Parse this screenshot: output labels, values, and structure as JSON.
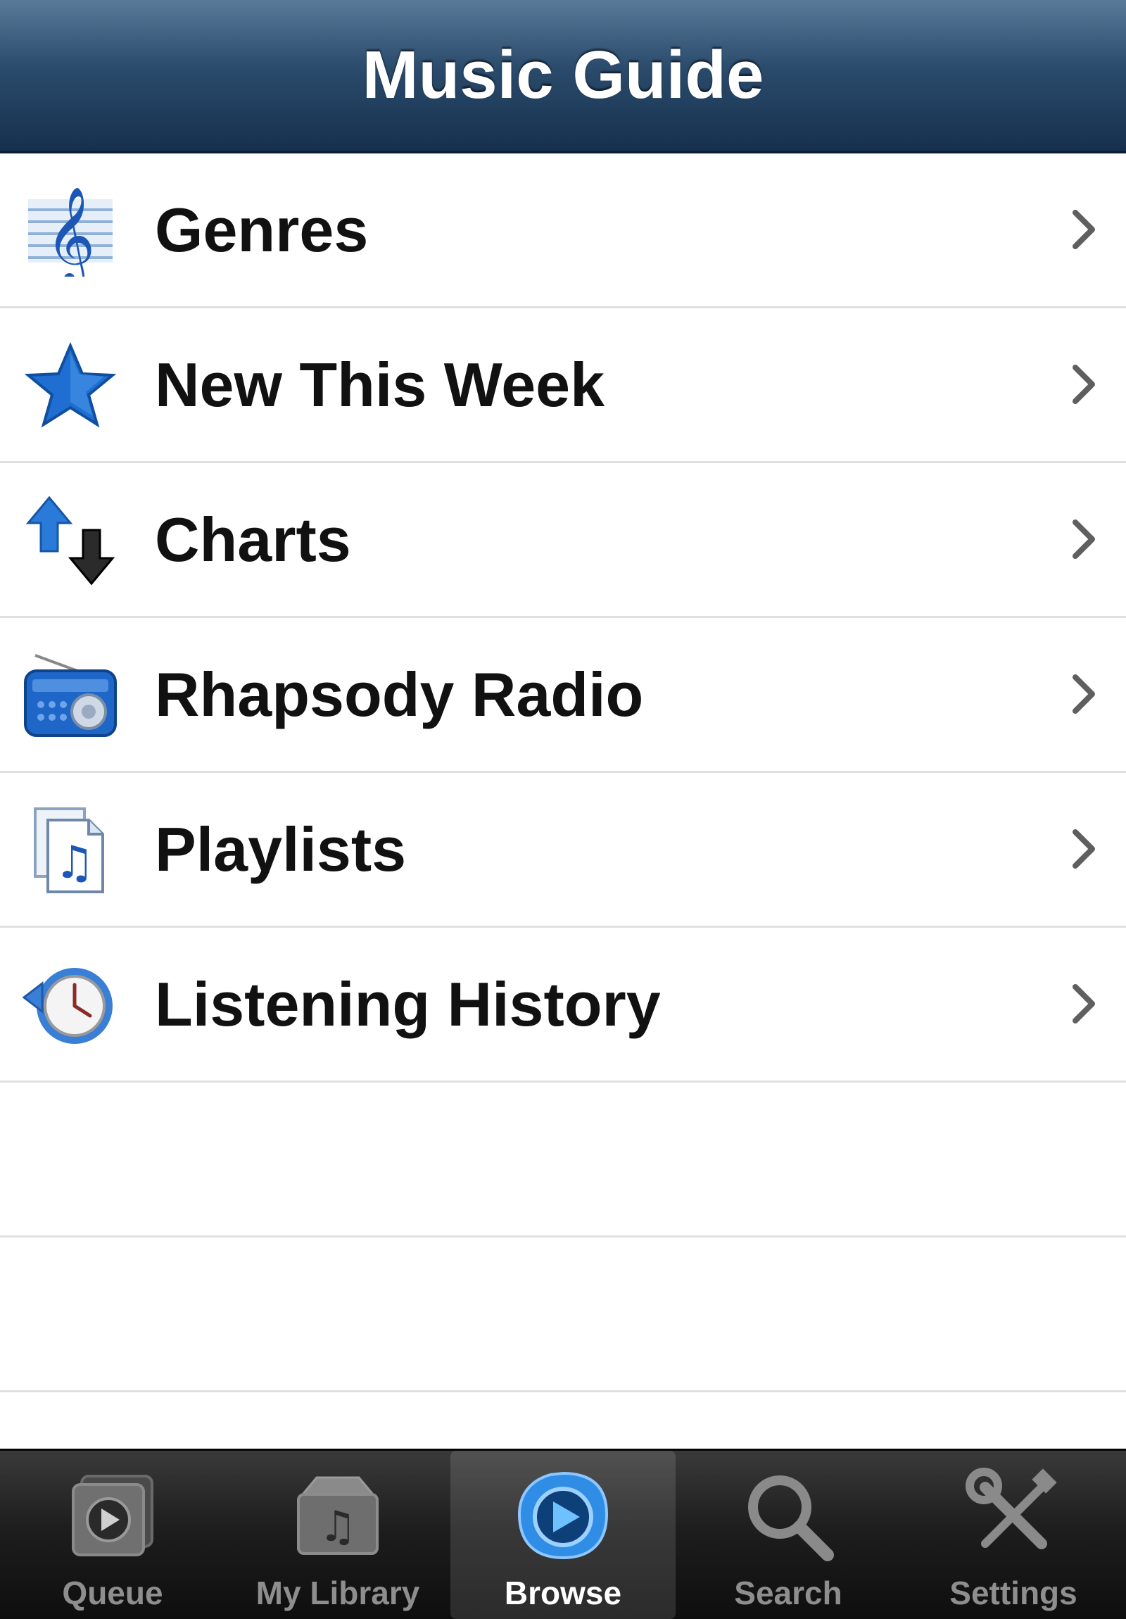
{
  "navbar": {
    "title": "Music Guide"
  },
  "menu": {
    "items": [
      {
        "label": "Genres",
        "icon": "treble-clef-icon"
      },
      {
        "label": "New This Week",
        "icon": "star-icon"
      },
      {
        "label": "Charts",
        "icon": "up-down-arrows-icon"
      },
      {
        "label": "Rhapsody Radio",
        "icon": "radio-icon"
      },
      {
        "label": "Playlists",
        "icon": "playlist-document-icon"
      },
      {
        "label": "Listening History",
        "icon": "history-clock-icon"
      }
    ]
  },
  "tabbar": {
    "active": "Browse",
    "tabs": [
      {
        "label": "Queue",
        "icon": "queue-play-icon"
      },
      {
        "label": "My Library",
        "icon": "library-box-icon"
      },
      {
        "label": "Browse",
        "icon": "browse-play-icon"
      },
      {
        "label": "Search",
        "icon": "magnifier-icon"
      },
      {
        "label": "Settings",
        "icon": "wrench-screwdriver-icon"
      }
    ]
  },
  "colors": {
    "navbar_top": "#5a7a9a",
    "navbar_bottom": "#16304d",
    "accent_blue": "#1e6fd1",
    "tabbar_bg": "#1e1e1e"
  }
}
